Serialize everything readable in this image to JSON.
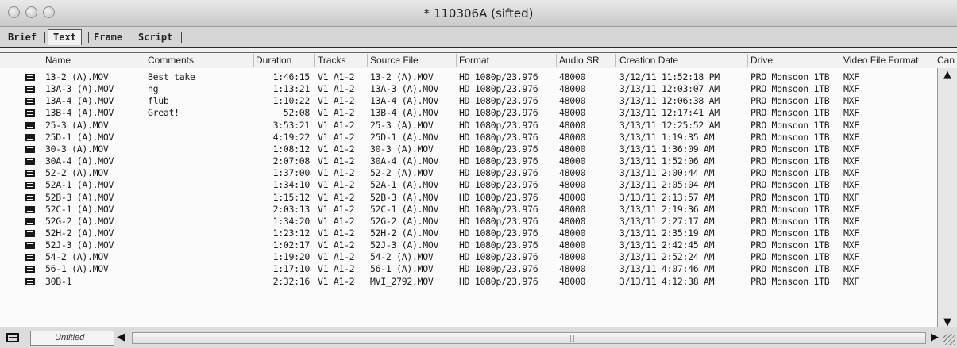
{
  "window": {
    "title": "* 110306A (sifted)"
  },
  "tabs": [
    {
      "label": "Brief"
    },
    {
      "label": "Text"
    },
    {
      "label": "Frame"
    },
    {
      "label": "Script"
    }
  ],
  "columns": [
    "Name",
    "Comments",
    "Duration",
    "Tracks",
    "Source File",
    "Format",
    "Audio SR",
    "Creation Date",
    "Drive",
    "Video File Format",
    "Can"
  ],
  "rows": [
    {
      "name": "13-2 (A).MOV",
      "comments": "Best take",
      "duration": "1:46:15",
      "tracks": "V1 A1-2",
      "source": "13-2 (A).MOV",
      "format": "HD 1080p/23.976",
      "audio_sr": "48000",
      "created": "3/12/11 11:52:18 PM",
      "drive": "PRO Monsoon 1TB",
      "vff": "MXF"
    },
    {
      "name": "13A-3 (A).MOV",
      "comments": "ng",
      "duration": "1:13:21",
      "tracks": "V1 A1-2",
      "source": "13A-3 (A).MOV",
      "format": "HD 1080p/23.976",
      "audio_sr": "48000",
      "created": "3/13/11 12:03:07 AM",
      "drive": "PRO Monsoon 1TB",
      "vff": "MXF"
    },
    {
      "name": "13A-4 (A).MOV",
      "comments": "flub",
      "duration": "1:10:22",
      "tracks": "V1 A1-2",
      "source": "13A-4 (A).MOV",
      "format": "HD 1080p/23.976",
      "audio_sr": "48000",
      "created": "3/13/11 12:06:38 AM",
      "drive": "PRO Monsoon 1TB",
      "vff": "MXF"
    },
    {
      "name": "13B-4 (A).MOV",
      "comments": "Great!",
      "duration": "52:08",
      "tracks": "V1 A1-2",
      "source": "13B-4 (A).MOV",
      "format": "HD 1080p/23.976",
      "audio_sr": "48000",
      "created": "3/13/11 12:17:41 AM",
      "drive": "PRO Monsoon 1TB",
      "vff": "MXF"
    },
    {
      "name": "25-3 (A).MOV",
      "comments": "",
      "duration": "3:53:21",
      "tracks": "V1 A1-2",
      "source": "25-3 (A).MOV",
      "format": "HD 1080p/23.976",
      "audio_sr": "48000",
      "created": "3/13/11 12:25:52 AM",
      "drive": "PRO Monsoon 1TB",
      "vff": "MXF"
    },
    {
      "name": "25D-1 (A).MOV",
      "comments": "",
      "duration": "4:19:22",
      "tracks": "V1 A1-2",
      "source": "25D-1 (A).MOV",
      "format": "HD 1080p/23.976",
      "audio_sr": "48000",
      "created": "3/13/11 1:19:35 AM",
      "drive": "PRO Monsoon 1TB",
      "vff": "MXF"
    },
    {
      "name": "30-3 (A).MOV",
      "comments": "",
      "duration": "1:08:12",
      "tracks": "V1 A1-2",
      "source": "30-3 (A).MOV",
      "format": "HD 1080p/23.976",
      "audio_sr": "48000",
      "created": "3/13/11 1:36:09 AM",
      "drive": "PRO Monsoon 1TB",
      "vff": "MXF"
    },
    {
      "name": "30A-4 (A).MOV",
      "comments": "",
      "duration": "2:07:08",
      "tracks": "V1 A1-2",
      "source": "30A-4 (A).MOV",
      "format": "HD 1080p/23.976",
      "audio_sr": "48000",
      "created": "3/13/11 1:52:06 AM",
      "drive": "PRO Monsoon 1TB",
      "vff": "MXF"
    },
    {
      "name": "52-2 (A).MOV",
      "comments": "",
      "duration": "1:37:00",
      "tracks": "V1 A1-2",
      "source": "52-2 (A).MOV",
      "format": "HD 1080p/23.976",
      "audio_sr": "48000",
      "created": "3/13/11 2:00:44 AM",
      "drive": "PRO Monsoon 1TB",
      "vff": "MXF"
    },
    {
      "name": "52A-1 (A).MOV",
      "comments": "",
      "duration": "1:34:10",
      "tracks": "V1 A1-2",
      "source": "52A-1 (A).MOV",
      "format": "HD 1080p/23.976",
      "audio_sr": "48000",
      "created": "3/13/11 2:05:04 AM",
      "drive": "PRO Monsoon 1TB",
      "vff": "MXF"
    },
    {
      "name": "52B-3 (A).MOV",
      "comments": "",
      "duration": "1:15:12",
      "tracks": "V1 A1-2",
      "source": "52B-3 (A).MOV",
      "format": "HD 1080p/23.976",
      "audio_sr": "48000",
      "created": "3/13/11 2:13:57 AM",
      "drive": "PRO Monsoon 1TB",
      "vff": "MXF"
    },
    {
      "name": "52C-1 (A).MOV",
      "comments": "",
      "duration": "2:03:13",
      "tracks": "V1 A1-2",
      "source": "52C-1 (A).MOV",
      "format": "HD 1080p/23.976",
      "audio_sr": "48000",
      "created": "3/13/11 2:19:36 AM",
      "drive": "PRO Monsoon 1TB",
      "vff": "MXF"
    },
    {
      "name": "52G-2 (A).MOV",
      "comments": "",
      "duration": "1:34:20",
      "tracks": "V1 A1-2",
      "source": "52G-2 (A).MOV",
      "format": "HD 1080p/23.976",
      "audio_sr": "48000",
      "created": "3/13/11 2:27:17 AM",
      "drive": "PRO Monsoon 1TB",
      "vff": "MXF"
    },
    {
      "name": "52H-2 (A).MOV",
      "comments": "",
      "duration": "1:23:12",
      "tracks": "V1 A1-2",
      "source": "52H-2 (A).MOV",
      "format": "HD 1080p/23.976",
      "audio_sr": "48000",
      "created": "3/13/11 2:35:19 AM",
      "drive": "PRO Monsoon 1TB",
      "vff": "MXF"
    },
    {
      "name": "52J-3 (A).MOV",
      "comments": "",
      "duration": "1:02:17",
      "tracks": "V1 A1-2",
      "source": "52J-3 (A).MOV",
      "format": "HD 1080p/23.976",
      "audio_sr": "48000",
      "created": "3/13/11 2:42:45 AM",
      "drive": "PRO Monsoon 1TB",
      "vff": "MXF"
    },
    {
      "name": "54-2 (A).MOV",
      "comments": "",
      "duration": "1:19:20",
      "tracks": "V1 A1-2",
      "source": "54-2 (A).MOV",
      "format": "HD 1080p/23.976",
      "audio_sr": "48000",
      "created": "3/13/11 2:52:24 AM",
      "drive": "PRO Monsoon 1TB",
      "vff": "MXF"
    },
    {
      "name": "56-1 (A).MOV",
      "comments": "",
      "duration": "1:17:10",
      "tracks": "V1 A1-2",
      "source": "56-1 (A).MOV",
      "format": "HD 1080p/23.976",
      "audio_sr": "48000",
      "created": "3/13/11 4:07:46 AM",
      "drive": "PRO Monsoon 1TB",
      "vff": "MXF"
    },
    {
      "name": "30B-1",
      "comments": "",
      "duration": "2:32:16",
      "tracks": "V1 A1-2",
      "source": "MVI_2792.MOV",
      "format": "HD 1080p/23.976",
      "audio_sr": "48000",
      "created": "3/13/11 4:12:38 AM",
      "drive": "PRO Monsoon 1TB",
      "vff": "MXF"
    }
  ],
  "footer": {
    "view_name": "Untitled"
  },
  "icons": {
    "clip": "clip-icon",
    "scroll_up": "arrow-up-icon",
    "scroll_down": "arrow-down-icon",
    "scroll_left": "arrow-left-icon",
    "scroll_right": "arrow-right-icon",
    "bin_menu": "bin-menu-icon"
  }
}
